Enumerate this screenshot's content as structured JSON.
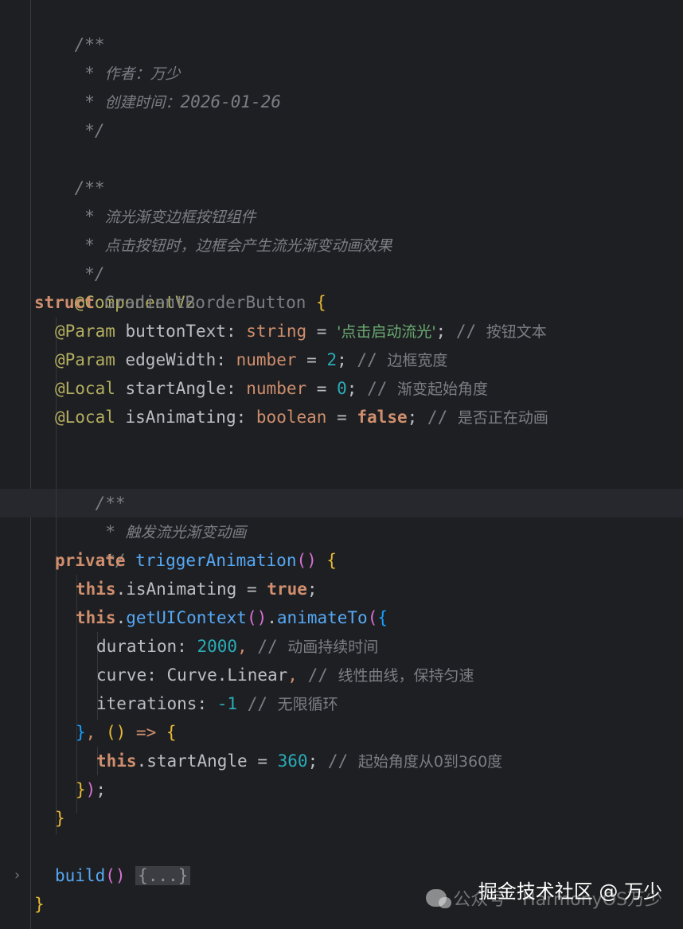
{
  "editor": {
    "lines": {
      "l01": "/**",
      "l02_star": " * ",
      "l02_text": "作者：万少",
      "l03_star": " * ",
      "l03_text": "创建时间：",
      "l03_date": "2026-01-26",
      "l04": " */",
      "l06": "/**",
      "l07_star": " * ",
      "l07_text": "流光渐变边框按钮组件",
      "l08_star": " * ",
      "l08_text": "点击按钮时，边框会产生流光渐变动画效果",
      "l09": " */",
      "l10": "@ComponentV2",
      "l11_kw": "struct",
      "l11_name": "GradientBorderButton",
      "l11_brace": "{",
      "p1_ann": "@Param",
      "p1_name": "buttonText",
      "p1_type": "string",
      "p1_value": "'点击启动流光'",
      "p1_comment": "按钮文本",
      "p2_ann": "@Param",
      "p2_name": "edgeWidth",
      "p2_type": "number",
      "p2_value": "2",
      "p2_comment": "边框宽度",
      "p3_ann": "@Local",
      "p3_name": "startAngle",
      "p3_type": "number",
      "p3_value": "0",
      "p3_comment": "渐变起始角度",
      "p4_ann": "@Local",
      "p4_name": "isAnimating",
      "p4_type": "boolean",
      "p4_value": "false",
      "p4_comment": "是否正在动画",
      "d1": "/**",
      "d2_star": " * ",
      "d2_text": "触发流光渐变动画",
      "d3": " */",
      "m_kw": "private",
      "m_name": "triggerAnimation",
      "a1_this": "this",
      "a1_prop": "isAnimating",
      "a1_val": "true",
      "a2_this": "this",
      "a2_fn1": "getUIContext",
      "a2_fn2": "animateTo",
      "o1_key": "duration",
      "o1_val": "2000",
      "o1_comment": "动画持续时间",
      "o2_key": "curve",
      "o2_cls": "Curve",
      "o2_prop": "Linear",
      "o2_comment": "线性曲线，保持匀速",
      "o3_key": "iterations",
      "o3_val": "-1",
      "o3_comment": "无限循环",
      "cb_this": "this",
      "cb_prop": "startAngle",
      "cb_val": "360",
      "cb_comment": "起始角度从0到360度",
      "b_name": "build",
      "b_fold": "{...}"
    },
    "fold_arrow": "›"
  },
  "watermark": {
    "main": "掘金技术社区 @ 万少",
    "sub": "公众号 · HarmonyOS万少",
    "logo_icon": "wechat-icon"
  },
  "colors": {
    "background": "#1e1f22",
    "keyword": "#cf8e6d",
    "comment": "#7a7e85",
    "annotation": "#b3ae60",
    "string": "#6aab73",
    "number": "#2aacb8",
    "function": "#56a8f5"
  }
}
